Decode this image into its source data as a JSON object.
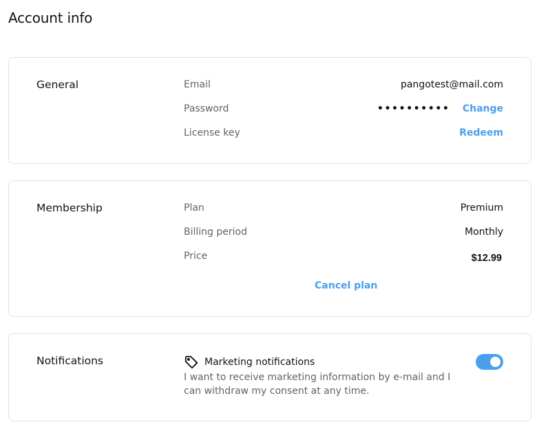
{
  "page": {
    "title": "Account info"
  },
  "general": {
    "title": "General",
    "email": {
      "label": "Email",
      "value": "pangotest@mail.com"
    },
    "password": {
      "label": "Password",
      "value": "••••••••••",
      "action": "Change"
    },
    "license_key": {
      "label": "License key",
      "action": "Redeem"
    }
  },
  "membership": {
    "title": "Membership",
    "plan": {
      "label": "Plan",
      "value": "Premium"
    },
    "billing_period": {
      "label": "Billing period",
      "value": "Monthly"
    },
    "price": {
      "label": "Price",
      "value": "$12.99"
    },
    "cancel_label": "Cancel plan"
  },
  "notifications": {
    "title": "Notifications",
    "marketing": {
      "icon": "tag-icon",
      "title": "Marketing notifications",
      "description": "I want to receive marketing information by e-mail and I can withdraw my consent at any time.",
      "enabled": true
    }
  },
  "colors": {
    "accent": "#4a9fea",
    "label_text": "#5f6368",
    "border": "#e3e3e3"
  }
}
